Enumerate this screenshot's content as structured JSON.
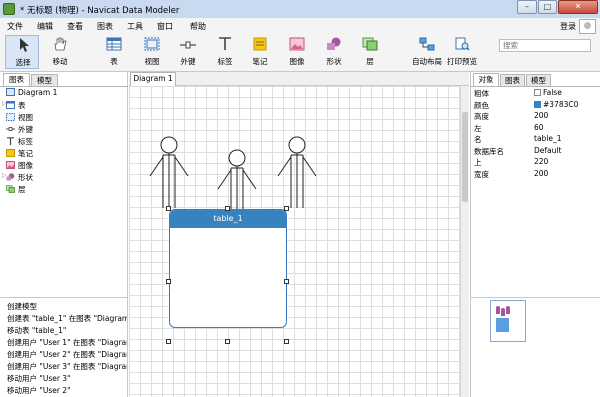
{
  "window": {
    "title": "* 无标题 (物理) - Navicat Data Modeler",
    "min_glyph": "–",
    "max_glyph": "□",
    "close_glyph": "✕"
  },
  "menu": {
    "items": [
      "文件",
      "编辑",
      "查看",
      "图表",
      "工具",
      "窗口",
      "帮助"
    ],
    "login": "登录"
  },
  "toolbar": {
    "tools": [
      {
        "label": "选择",
        "icon": "pointer-icon"
      },
      {
        "label": "移动",
        "icon": "hand-icon"
      },
      {
        "label": "表",
        "icon": "table-icon"
      },
      {
        "label": "视图",
        "icon": "view-icon"
      },
      {
        "label": "外键",
        "icon": "foreign-key-icon"
      },
      {
        "label": "标签",
        "icon": "label-icon"
      },
      {
        "label": "笔记",
        "icon": "note-icon"
      },
      {
        "label": "图像",
        "icon": "image-icon"
      },
      {
        "label": "形状",
        "icon": "shape-icon"
      },
      {
        "label": "层",
        "icon": "layer-icon"
      },
      {
        "label": "自动布局",
        "icon": "auto-layout-icon"
      },
      {
        "label": "打印预览",
        "icon": "print-preview-icon"
      }
    ],
    "search_placeholder": "搜索"
  },
  "left_panel": {
    "tabs": [
      "图表",
      "模型"
    ],
    "tree": [
      {
        "label": "Diagram 1",
        "icon": "diagram-icon",
        "expandable": false
      },
      {
        "label": "表",
        "icon": "table-icon",
        "expandable": true
      },
      {
        "label": "视图",
        "icon": "view-icon",
        "expandable": false
      },
      {
        "label": "外键",
        "icon": "foreign-key-icon",
        "expandable": false
      },
      {
        "label": "标签",
        "icon": "label-icon",
        "expandable": false
      },
      {
        "label": "笔记",
        "icon": "note-icon",
        "expandable": false
      },
      {
        "label": "图像",
        "icon": "image-icon",
        "expandable": false
      },
      {
        "label": "形状",
        "icon": "shape-icon",
        "expandable": true
      },
      {
        "label": "层",
        "icon": "layer-icon",
        "expandable": false
      }
    ]
  },
  "history": [
    "创建模型",
    "创建表 \"table_1\" 在图表 \"Diagram",
    "移动表 \"table_1\"",
    "创建用户 \"User 1\" 在图表 \"Diagram",
    "创建用户 \"User 2\" 在图表 \"Diagram",
    "创建用户 \"User 3\" 在图表 \"Diagram",
    "移动用户 \"User 3\"",
    "移动用户 \"User 2\""
  ],
  "canvas": {
    "tab_label": "Diagram 1",
    "table_name": "table_1"
  },
  "right_panel": {
    "tabs": [
      "对象",
      "图表",
      "模型"
    ],
    "properties": [
      {
        "key": "粗体",
        "value": "False",
        "kind": "checkbox"
      },
      {
        "key": "颜色",
        "value": "#3783C0",
        "kind": "color"
      },
      {
        "key": "高度",
        "value": "200",
        "kind": "text"
      },
      {
        "key": "左",
        "value": "60",
        "kind": "text"
      },
      {
        "key": "名",
        "value": "table_1",
        "kind": "text"
      },
      {
        "key": "数据库名",
        "value": "Default",
        "kind": "text"
      },
      {
        "key": "上",
        "value": "220",
        "kind": "text"
      },
      {
        "key": "宽度",
        "value": "200",
        "kind": "text"
      }
    ]
  },
  "colors": {
    "table_header": "#3783C0",
    "user_icon": "#A7559E"
  }
}
